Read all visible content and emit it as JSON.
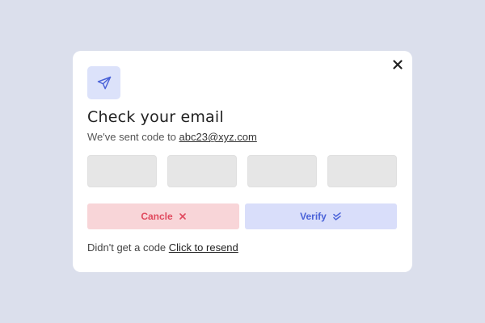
{
  "dialog": {
    "title": "Check your email",
    "subtitle_prefix": "We've sent code to ",
    "email": "abc23@xyz.com",
    "otp_fields": [
      {
        "value": "",
        "placeholder": ""
      },
      {
        "value": "",
        "placeholder": ""
      },
      {
        "value": "",
        "placeholder": ""
      },
      {
        "value": "",
        "placeholder": ""
      }
    ],
    "cancel_label": "Cancle",
    "verify_label": "Verify",
    "resend_prefix": "Didn't get a code ",
    "resend_link": "Click to resend",
    "icons": {
      "header": "paper-plane-icon",
      "close": "close-icon",
      "cancel": "x-icon",
      "verify": "double-check-icon"
    }
  },
  "colors": {
    "page_background": "#dbdfec",
    "card_background": "#ffffff",
    "icon_box": "#dce2fa",
    "icon_accent": "#4a62d8",
    "cancel_bg": "#f8d5d8",
    "cancel_text": "#e04a5e",
    "verify_bg": "#d9defa",
    "verify_text": "#4a62d8",
    "otp_box": "#e6e6e6"
  }
}
